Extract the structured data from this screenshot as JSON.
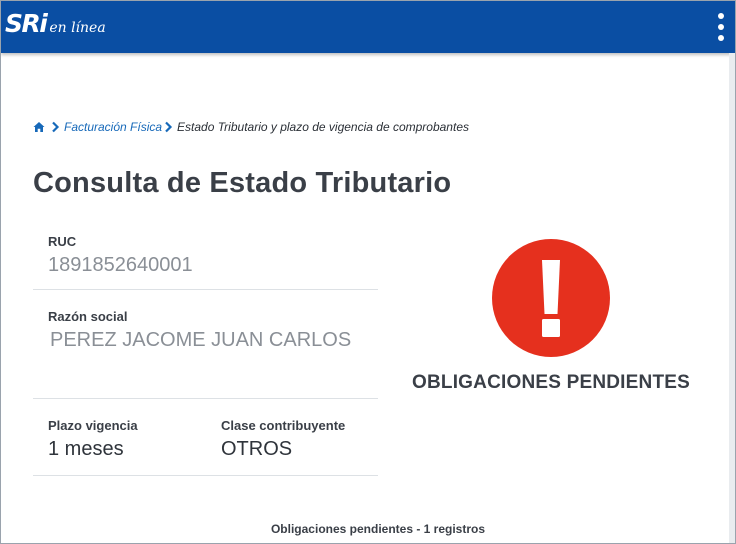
{
  "header": {
    "logo_main": "SRi",
    "logo_sub": "en línea",
    "brand_color": "#0a4ea3"
  },
  "breadcrumb": {
    "home_icon": "home-icon",
    "items": [
      {
        "label": "Facturación Física"
      },
      {
        "label": "Estado Tributario y plazo de vigencia de comprobantes"
      }
    ]
  },
  "page": {
    "title": "Consulta de Estado Tributario"
  },
  "taxpayer": {
    "ruc_label": "RUC",
    "ruc_value": "1891852640001",
    "razon_label": "Razón social",
    "razon_value": "PEREZ JACOME JUAN CARLOS",
    "plazo_label": "Plazo vigencia",
    "plazo_value": "1 meses",
    "clase_label": "Clase contribuyente",
    "clase_value": "OTROS"
  },
  "status": {
    "icon": "exclamation-circle-icon",
    "text": "OBLIGACIONES PENDIENTES",
    "color": "#e5301e"
  },
  "footer": {
    "caption": "Obligaciones pendientes - 1 registros"
  }
}
